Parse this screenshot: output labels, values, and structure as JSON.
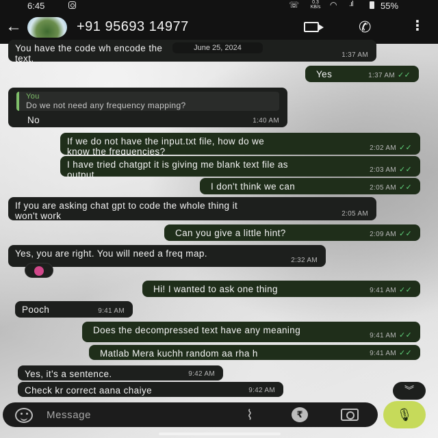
{
  "status_bar": {
    "time": "6:45",
    "network_speed": "0.3\nKB/s",
    "battery": "55%"
  },
  "header": {
    "contact_name": "+91 95693 14977"
  },
  "date_chip": "June 25, 2024",
  "messages": [
    {
      "dir": "in",
      "text": "You have the code wh          encode the\ntext.",
      "time": "1:37 AM"
    },
    {
      "dir": "out",
      "text": "Yes",
      "time": "1:37 AM"
    },
    {
      "dir": "in",
      "quote_author": "You",
      "quote_text": "Do we not need any frequency mapping?",
      "text": "No",
      "time": "1:40 AM"
    },
    {
      "dir": "out",
      "text": "If we do not have the input.txt file, how do we\nknow the frequencies?",
      "time": "2:02 AM"
    },
    {
      "dir": "out",
      "text": "I have tried chatgpt it is giving me blank text file as\noutput",
      "time": "2:03 AM"
    },
    {
      "dir": "out",
      "text": "I don't think we can",
      "time": "2:05 AM"
    },
    {
      "dir": "in",
      "text": "If you are asking chat gpt to code the whole thing it\nwon't work",
      "time": "2:05 AM"
    },
    {
      "dir": "out",
      "text": "Can you give a little hint?",
      "time": "2:09 AM"
    },
    {
      "dir": "in",
      "text": "Yes, you are right. You will need a freq map.",
      "time": "2:32 AM"
    },
    {
      "dir": "out",
      "text": "Hi! I wanted to ask one thing",
      "time": "9:41 AM"
    },
    {
      "dir": "in",
      "text": "Pooch",
      "time": "9:41 AM"
    },
    {
      "dir": "out",
      "text": "Does the decompressed text have any meaning",
      "time": "9:41 AM"
    },
    {
      "dir": "out",
      "text": "Matlab Mera kuchh random aa rha h",
      "time": "9:41 AM"
    },
    {
      "dir": "in",
      "text": "Yes, it's a sentence.",
      "time": "9:42 AM"
    },
    {
      "dir": "in",
      "text": "Check kr correct aana chaiye",
      "time": "9:42 AM"
    }
  ],
  "composer": {
    "placeholder": "Message"
  },
  "icons": {
    "back": "arrow-left-icon",
    "video": "video-call-icon",
    "call": "phone-icon",
    "menu": "more-vertical-icon",
    "emoji": "emoji-icon",
    "attach": "paperclip-icon",
    "payment": "rupee-icon",
    "camera": "camera-icon",
    "mic": "mic-icon",
    "scroll": "double-chevron-down-icon"
  },
  "colors": {
    "incoming_bubble": "#1d1f1d",
    "outgoing_bubble": "#1f2e1a",
    "read_ticks": "#5fd07a",
    "mic_button": "#c6da5a"
  }
}
